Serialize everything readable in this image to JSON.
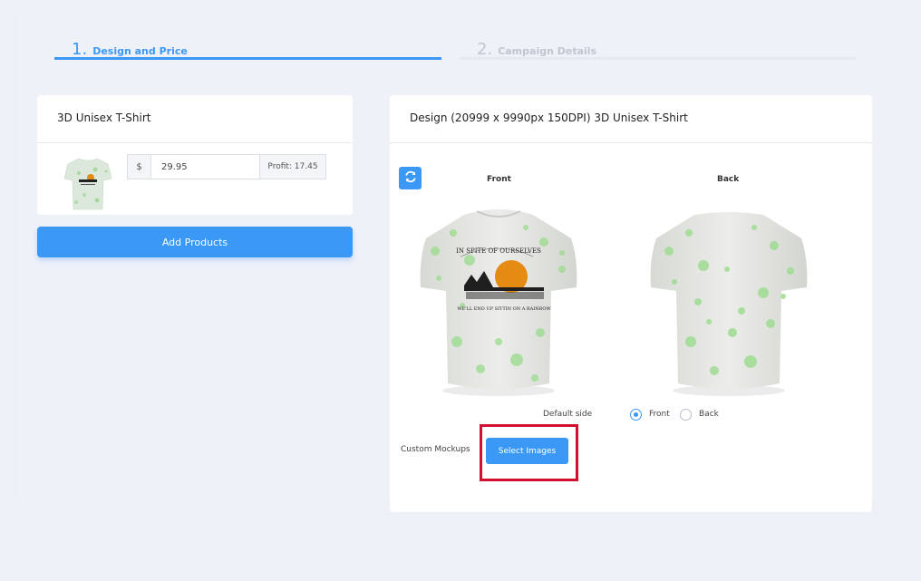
{
  "steps": [
    {
      "number": "1.",
      "label": "Design and Price"
    },
    {
      "number": "2.",
      "label": "Campaign Details"
    }
  ],
  "product_card": {
    "title": "3D Unisex T-Shirt",
    "currency_symbol": "$",
    "price": "29.95",
    "profit": "Profit: 17.45"
  },
  "add_products_label": "Add Products",
  "design_card": {
    "title": "Design (20999 x 9990px 150DPI) 3D Unisex T-Shirt",
    "front_label": "Front",
    "back_label": "Back",
    "default_side_label": "Default side",
    "radio_front_label": "Front",
    "radio_back_label": "Back",
    "default_side_selected": "Front",
    "custom_mockups_label": "Custom Mockups",
    "select_images_label": "Select Images"
  },
  "print_text": {
    "top": "IN SPITE OF OURSELVES",
    "bottom": "WE'LL END UP SITTIN ON A RAINBOW"
  },
  "colors": {
    "accent": "#3b99f5",
    "highlight": "#d0102d",
    "page_bg": "#eef0f8"
  },
  "icons": [
    "refresh-icon",
    "radio-selected-icon",
    "radio-unselected-icon"
  ]
}
